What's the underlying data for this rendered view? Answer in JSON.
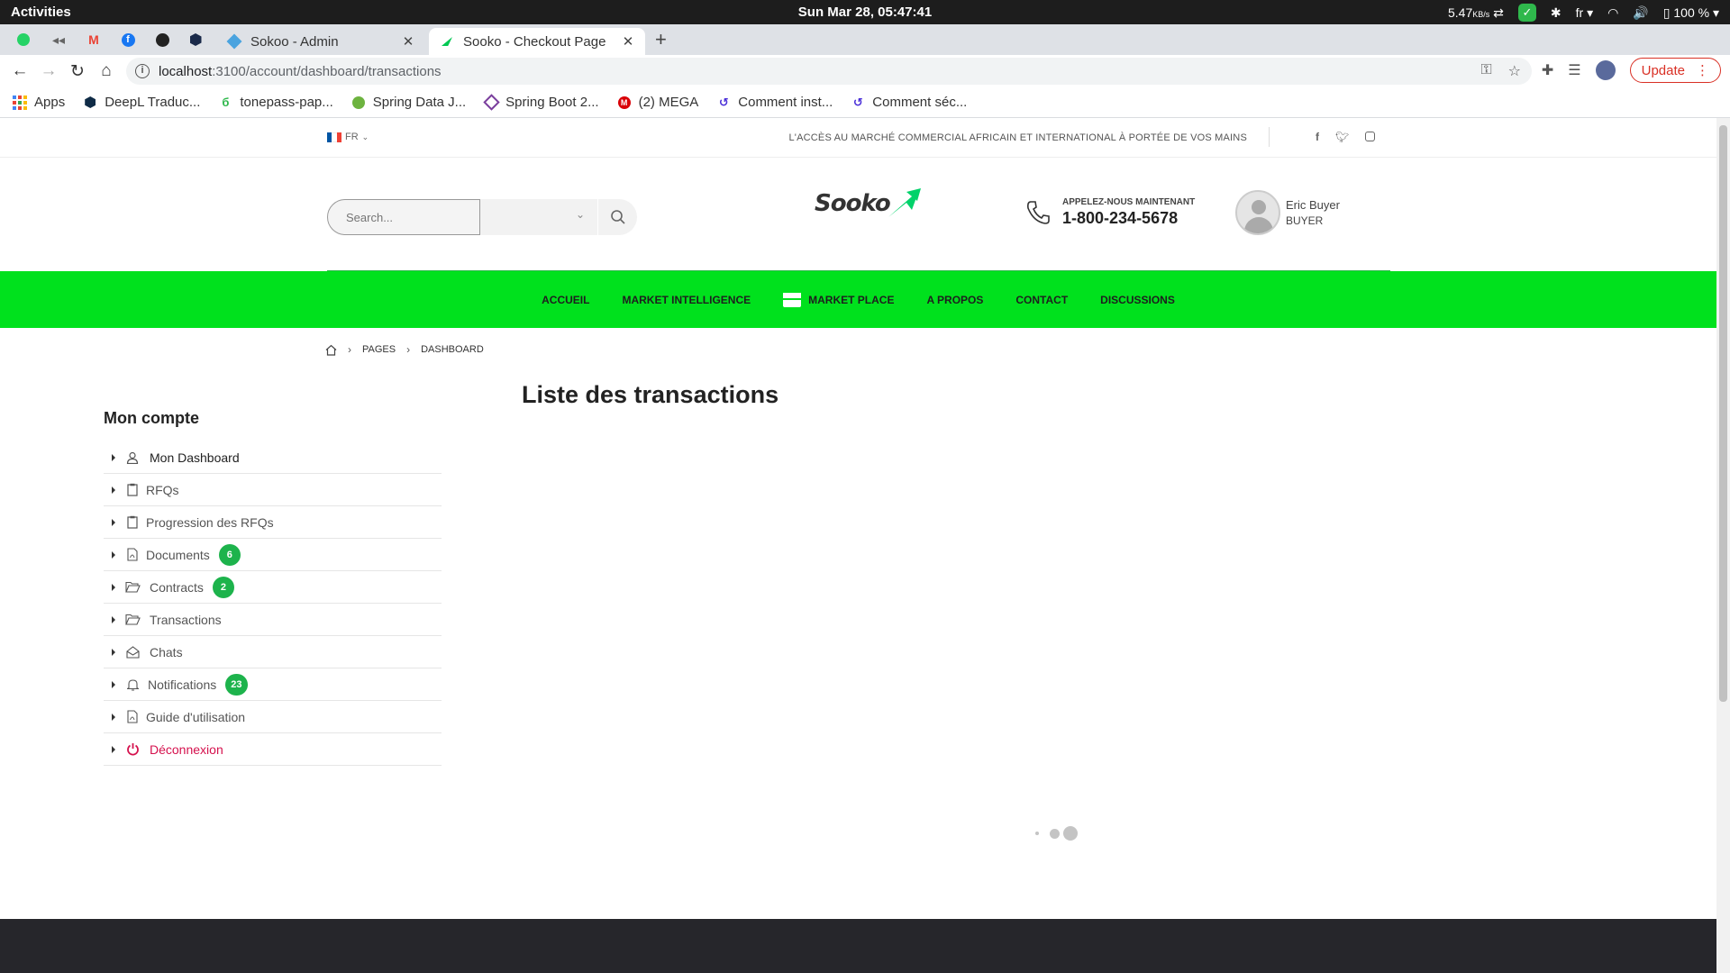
{
  "system_bar": {
    "activities": "Activities",
    "clock": "Sun Mar 28, 05:47:41",
    "net_speed": "5.47",
    "net_unit": "KB/s",
    "keyboard_lang": "fr",
    "battery": "100 %"
  },
  "browser": {
    "tabs": [
      {
        "title": "Sokoo - Admin",
        "active": false
      },
      {
        "title": "Sooko - Checkout Page",
        "active": true
      }
    ],
    "url_host": "localhost",
    "url_path": ":3100/account/dashboard/transactions",
    "update_label": "Update",
    "bookmarks": [
      {
        "label": "Apps",
        "icon": "apps-grid-icon"
      },
      {
        "label": "DeepL Traduc...",
        "icon": "deepl-icon"
      },
      {
        "label": "tonepass-pap...",
        "icon": "tonepass-icon"
      },
      {
        "label": "Spring Data J...",
        "icon": "spring-icon"
      },
      {
        "label": "Spring Boot 2...",
        "icon": "spring-boot-icon"
      },
      {
        "label": "(2) MEGA",
        "icon": "mega-icon"
      },
      {
        "label": "Comment inst...",
        "icon": "comment-icon"
      },
      {
        "label": "Comment séc...",
        "icon": "comment-icon"
      }
    ]
  },
  "topbar": {
    "language": "FR",
    "tagline": "L'ACCÈS AU MARCHÉ COMMERCIAL AFRICAIN ET INTERNATIONAL À PORTÉE DE VOS MAINS"
  },
  "header": {
    "search_placeholder": "Search...",
    "logo_text": "Sooko",
    "call_label": "APPELEZ-NOUS MAINTENANT",
    "call_number": "1-800-234-5678",
    "user_name": "Eric Buyer",
    "user_role": "BUYER"
  },
  "nav": {
    "items": [
      "ACCUEIL",
      "MARKET INTELLIGENCE",
      "MARKET PLACE",
      "A PROPOS",
      "CONTACT",
      "DISCUSSIONS"
    ]
  },
  "breadcrumb": {
    "items": [
      "PAGES",
      "DASHBOARD"
    ]
  },
  "main": {
    "title": "Liste des transactions"
  },
  "sidebar": {
    "title": "Mon compte",
    "items": [
      {
        "label": "Mon Dashboard",
        "icon": "user-icon"
      },
      {
        "label": "RFQs",
        "icon": "clipboard-icon"
      },
      {
        "label": "Progression des RFQs",
        "icon": "clipboard-icon"
      },
      {
        "label": "Documents",
        "icon": "pdf-file-icon",
        "badge": "6"
      },
      {
        "label": "Contracts",
        "icon": "folder-open-icon",
        "badge": "2"
      },
      {
        "label": "Transactions",
        "icon": "folder-open-icon"
      },
      {
        "label": "Chats",
        "icon": "envelope-open-icon"
      },
      {
        "label": "Notifications",
        "icon": "bell-icon",
        "badge": "23"
      },
      {
        "label": "Guide d'utilisation",
        "icon": "pdf-file-icon"
      },
      {
        "label": "Déconnexion",
        "icon": "power-icon"
      }
    ]
  },
  "colors": {
    "nav_green": "#00e11d",
    "badge_green": "#1db34c",
    "logout_red": "#d5114d",
    "footer_dark": "#26262b"
  }
}
